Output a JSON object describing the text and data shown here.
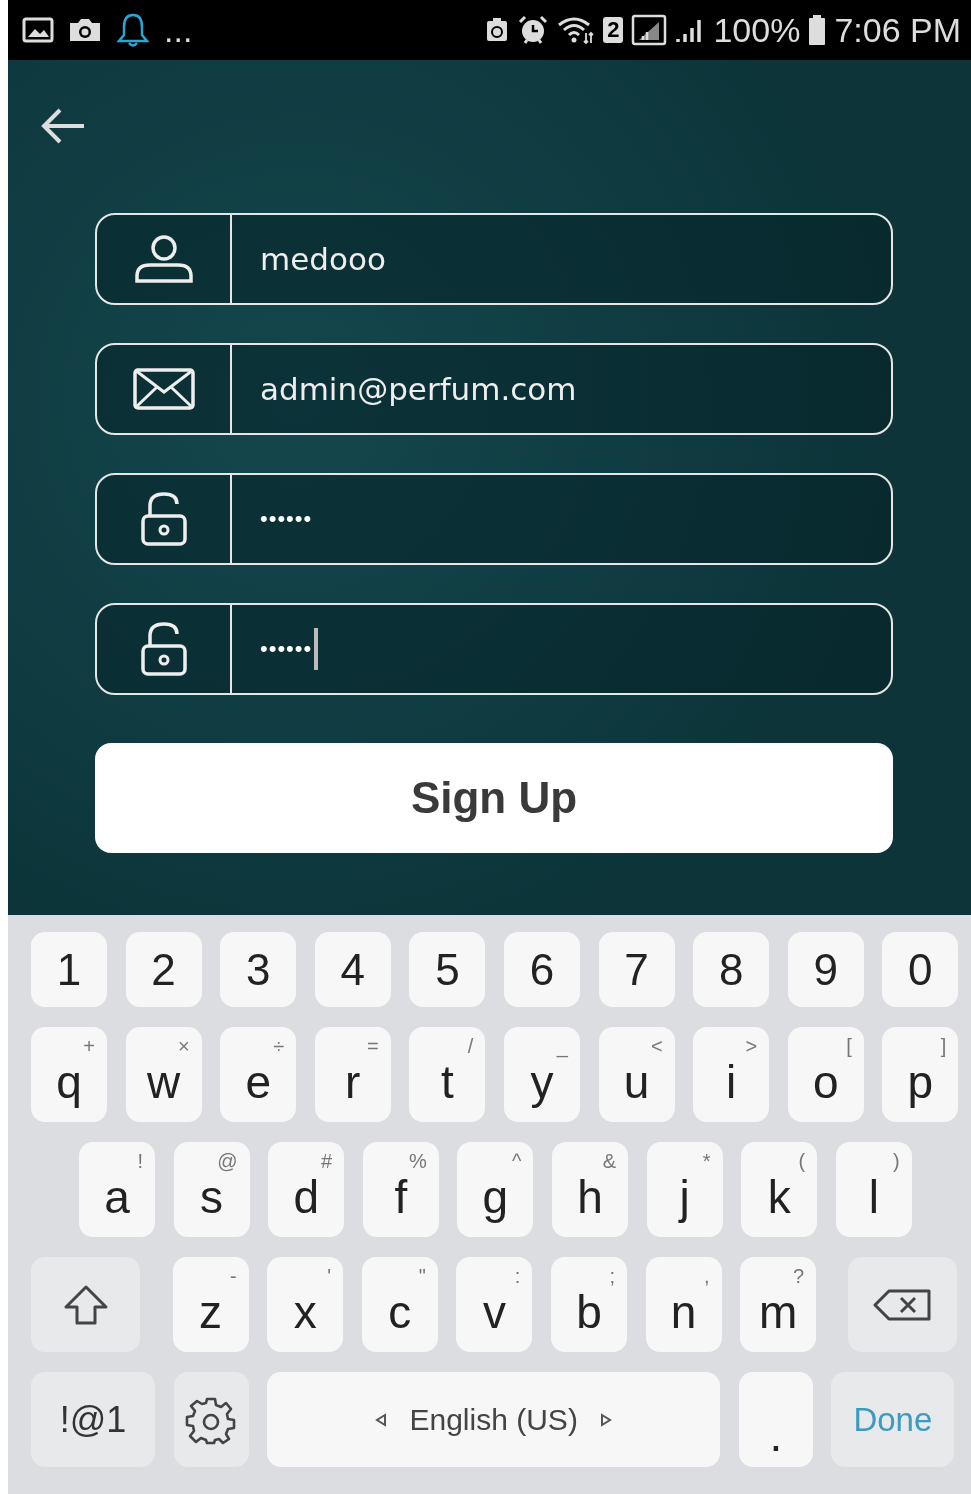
{
  "status_bar": {
    "overflow": "...",
    "sim_badge": "2",
    "battery": "100%",
    "time": "7:06 PM"
  },
  "fields": [
    {
      "kind": "username",
      "value": "medooo",
      "focused": false
    },
    {
      "kind": "email",
      "value": "admin@perfum.com",
      "focused": false
    },
    {
      "kind": "password",
      "value": "••••••",
      "focused": false
    },
    {
      "kind": "password",
      "value": "••••••",
      "focused": true
    }
  ],
  "sign_up_button": "Sign Up",
  "keyboard": {
    "digits": [
      "1",
      "2",
      "3",
      "4",
      "5",
      "6",
      "7",
      "8",
      "9",
      "0"
    ],
    "letter_rows": [
      [
        {
          "label": "q",
          "hint": "+"
        },
        {
          "label": "w",
          "hint": "×"
        },
        {
          "label": "e",
          "hint": "÷"
        },
        {
          "label": "r",
          "hint": "="
        },
        {
          "label": "t",
          "hint": "/"
        },
        {
          "label": "y",
          "hint": "_"
        },
        {
          "label": "u",
          "hint": "<"
        },
        {
          "label": "i",
          "hint": ">"
        },
        {
          "label": "o",
          "hint": "["
        },
        {
          "label": "p",
          "hint": "]"
        }
      ],
      [
        {
          "label": "a",
          "hint": "!"
        },
        {
          "label": "s",
          "hint": "@"
        },
        {
          "label": "d",
          "hint": "#"
        },
        {
          "label": "f",
          "hint": "%"
        },
        {
          "label": "g",
          "hint": "^"
        },
        {
          "label": "h",
          "hint": "&"
        },
        {
          "label": "j",
          "hint": "*"
        },
        {
          "label": "k",
          "hint": "("
        },
        {
          "label": "l",
          "hint": ")"
        }
      ],
      [
        {
          "label": "z",
          "hint": "-"
        },
        {
          "label": "x",
          "hint": "'"
        },
        {
          "label": "c",
          "hint": "\""
        },
        {
          "label": "v",
          "hint": ":"
        },
        {
          "label": "b",
          "hint": ";"
        },
        {
          "label": "n",
          "hint": ","
        },
        {
          "label": "m",
          "hint": "?"
        }
      ]
    ],
    "symbols_key": "!@1",
    "space_key": "English (US)",
    "period_key": ".",
    "done_key": "Done"
  }
}
